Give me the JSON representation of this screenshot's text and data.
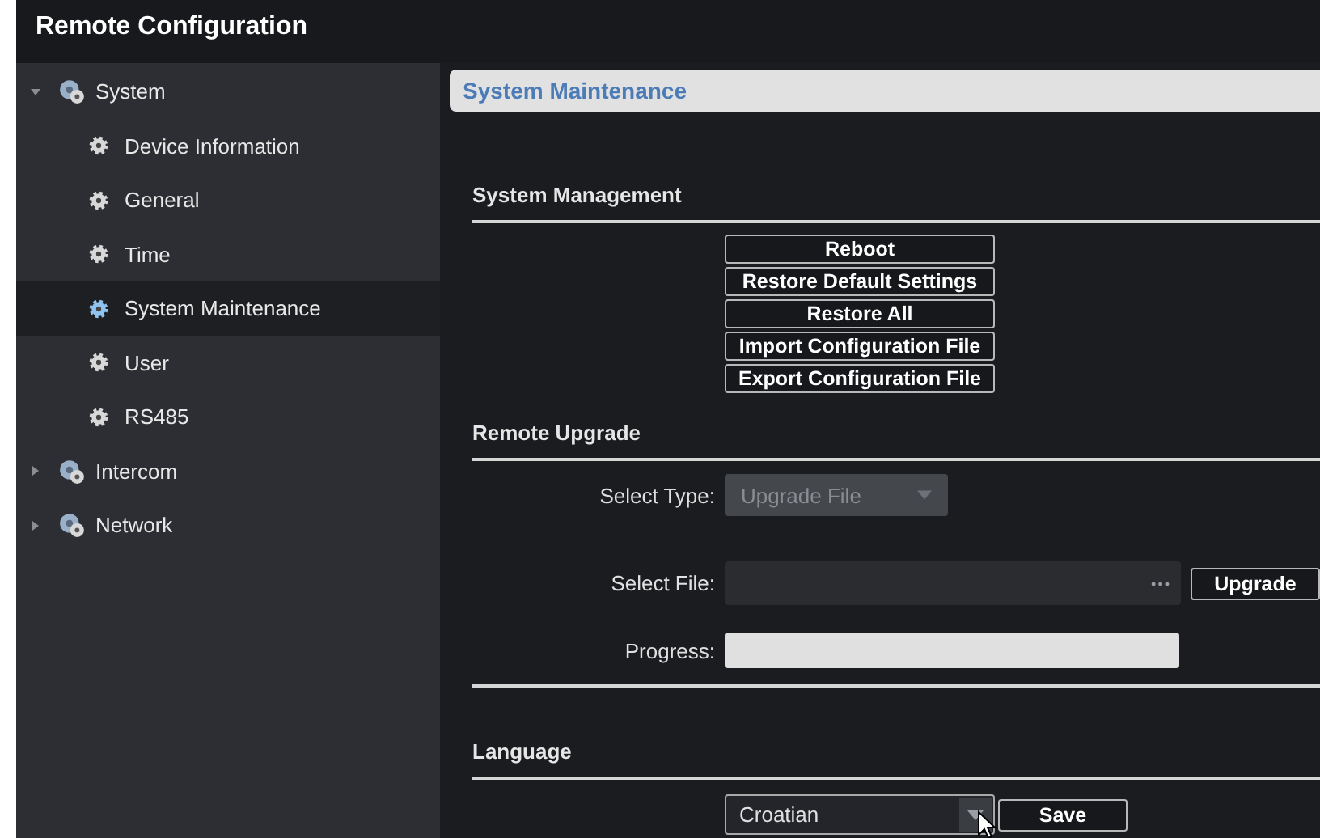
{
  "window": {
    "title": "Remote Configuration"
  },
  "sidebar": {
    "items": [
      {
        "label": "System",
        "expanded": true,
        "selected": false,
        "children": [
          {
            "label": "Device Information",
            "selected": false
          },
          {
            "label": "General",
            "selected": false
          },
          {
            "label": "Time",
            "selected": false
          },
          {
            "label": "System Maintenance",
            "selected": true
          },
          {
            "label": "User",
            "selected": false
          },
          {
            "label": "RS485",
            "selected": false
          }
        ]
      },
      {
        "label": "Intercom",
        "expanded": false,
        "selected": false
      },
      {
        "label": "Network",
        "expanded": false,
        "selected": false
      }
    ]
  },
  "page": {
    "title": "System Maintenance",
    "system_management": {
      "title": "System Management",
      "buttons": [
        "Reboot",
        "Restore Default Settings",
        "Restore All",
        "Import Configuration File",
        "Export Configuration File"
      ]
    },
    "remote_upgrade": {
      "title": "Remote Upgrade",
      "select_type": {
        "label": "Select Type:",
        "value": "Upgrade File",
        "disabled": true
      },
      "select_file": {
        "label": "Select File:",
        "browse": "•••",
        "button": "Upgrade"
      },
      "progress": {
        "label": "Progress:",
        "level": 0
      }
    },
    "language": {
      "title": "Language",
      "value": "Croatian",
      "button": "Save"
    }
  }
}
